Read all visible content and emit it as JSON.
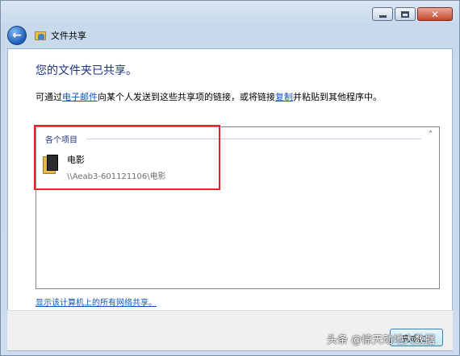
{
  "window": {
    "title": "文件共享",
    "minimize_icon": "minimize-icon",
    "maximize_icon": "maximize-icon",
    "close_icon": "close-icon"
  },
  "nav": {
    "back_icon": "back-arrow-icon",
    "title": "文件共享"
  },
  "main": {
    "heading": "您的文件夹已共享。",
    "description": {
      "part1": "可通过",
      "email_link": "电子邮件",
      "part2": "向某个人发送到这些共享项的链接，或将链接",
      "copy_link": "复制",
      "part3": "并粘贴到其他程序中。"
    },
    "list": {
      "group_label": "各个项目",
      "items": [
        {
          "name": "电影",
          "path": "\\\\Aeab3-601121106\\电影"
        }
      ]
    },
    "show_all_link": "显示该计算机上的所有网络共享。"
  },
  "footer": {
    "done_label": "完成(D)"
  },
  "watermark": "头条 @惊天动地大数据",
  "colors": {
    "heading": "#1e3287",
    "link": "#0f55b5",
    "highlight": "#e5252b"
  }
}
